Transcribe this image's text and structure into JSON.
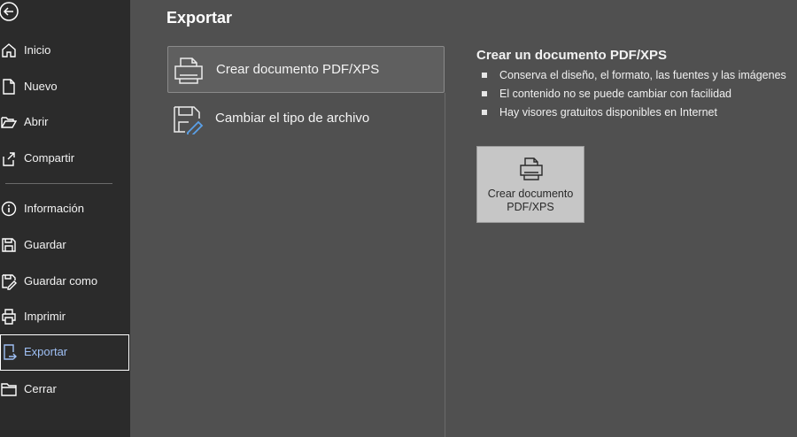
{
  "backstage": {
    "back_icon": "back-arrow-icon",
    "items": [
      {
        "id": "inicio",
        "label": "Inicio",
        "icon": "home-icon"
      },
      {
        "id": "nuevo",
        "label": "Nuevo",
        "icon": "new-document-icon"
      },
      {
        "id": "abrir",
        "label": "Abrir",
        "icon": "open-folder-icon"
      },
      {
        "id": "compartir",
        "label": "Compartir",
        "icon": "share-icon"
      },
      {
        "id": "informacion",
        "label": "Información",
        "icon": "info-icon"
      },
      {
        "id": "guardar",
        "label": "Guardar",
        "icon": "save-icon"
      },
      {
        "id": "guardar-como",
        "label": "Guardar como",
        "icon": "save-as-icon"
      },
      {
        "id": "imprimir",
        "label": "Imprimir",
        "icon": "printer-icon"
      },
      {
        "id": "exportar",
        "label": "Exportar",
        "icon": "export-icon",
        "active": true
      },
      {
        "id": "cerrar",
        "label": "Cerrar",
        "icon": "close-folder-icon"
      }
    ]
  },
  "main": {
    "title": "Exportar",
    "options": [
      {
        "label": "Crear documento PDF/XPS",
        "icon": "pdf-printer-icon",
        "selected": true
      },
      {
        "label": "Cambiar el tipo de archivo",
        "icon": "change-file-type-icon",
        "selected": false
      }
    ],
    "detail": {
      "title": "Crear un documento PDF/XPS",
      "bullets": [
        "Conserva el diseño, el formato, las fuentes y las imágenes",
        "El contenido no se puede cambiar con facilidad",
        "Hay visores gratuitos disponibles en Internet"
      ],
      "button_label": "Crear documento\nPDF/XPS",
      "button_icon": "pdf-printer-icon"
    }
  },
  "colors": {
    "nav_bg": "#2b2b2b",
    "main_bg": "#505050",
    "active_text": "#9fc0f5",
    "button_bg": "#c6c6c6"
  }
}
